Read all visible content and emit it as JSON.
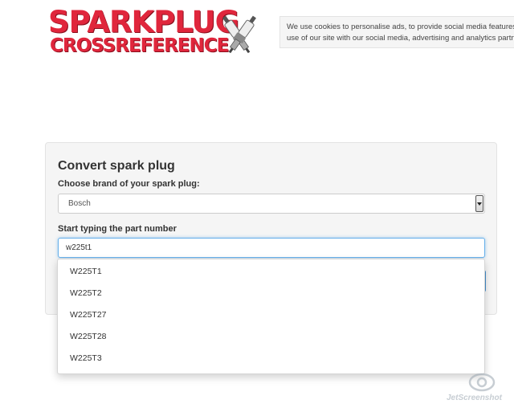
{
  "logo": {
    "line1": "SPARKPLUG",
    "line2": "CROSSREFERENCE",
    "icon": "spark-plugs-icon",
    "color": "#e0263c"
  },
  "cookie_notice": {
    "line1": "We use cookies to personalise ads, to provide social media features",
    "line2": "use of our site with our social media, advertising and analytics partne"
  },
  "form": {
    "title": "Convert spark plug",
    "brand_label": "Choose brand of your spark plug:",
    "brand_value": "Bosch",
    "part_label": "Start typing the part number",
    "part_value": "w225t1"
  },
  "suggestions": [
    "W225T1",
    "W225T2",
    "W225T27",
    "W225T28",
    "W225T3"
  ],
  "watermark": {
    "text": "JetScreenshot",
    "icon": "camera-eye-icon"
  },
  "colors": {
    "brand_red": "#e0263c",
    "focus_blue": "#66afe9",
    "button_blue": "#428bca"
  }
}
